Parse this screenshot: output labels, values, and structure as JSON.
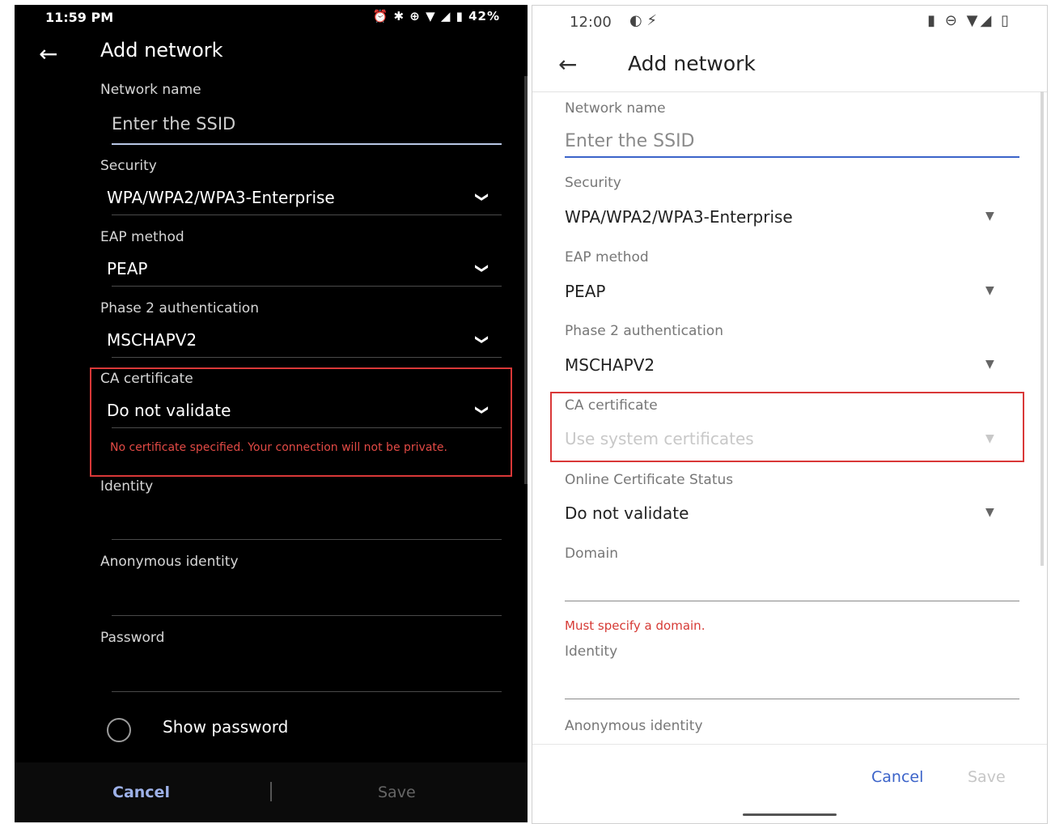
{
  "dark_phone": {
    "status": {
      "time": "11:59 PM",
      "icons": "⏰ ✱ ⊕ ▼ ◢ ▮ 42%"
    },
    "title": "Add network",
    "network_name": {
      "label": "Network name",
      "placeholder": "Enter the SSID"
    },
    "security": {
      "label": "Security",
      "value": "WPA/WPA2/WPA3-Enterprise"
    },
    "eap_method": {
      "label": "EAP method",
      "value": "PEAP"
    },
    "phase2": {
      "label": "Phase 2 authentication",
      "value": "MSCHAPV2"
    },
    "ca_certificate": {
      "label": "CA certificate",
      "value": "Do not validate",
      "warning": "No certificate specified. Your connection will not be private."
    },
    "identity": {
      "label": "Identity"
    },
    "anonymous_identity": {
      "label": "Anonymous identity"
    },
    "password": {
      "label": "Password"
    },
    "show_password": "Show password",
    "buttons": {
      "cancel": "Cancel",
      "save": "Save"
    }
  },
  "light_phone": {
    "status": {
      "time": "12:00",
      "left_icons": "◐ ⚡",
      "right_icons": "▮ ⊖ ▼◢ ▯"
    },
    "title": "Add network",
    "network_name": {
      "label": "Network name",
      "placeholder": "Enter the SSID"
    },
    "security": {
      "label": "Security",
      "value": "WPA/WPA2/WPA3-Enterprise"
    },
    "eap_method": {
      "label": "EAP method",
      "value": "PEAP"
    },
    "phase2": {
      "label": "Phase 2 authentication",
      "value": "MSCHAPV2"
    },
    "ca_certificate": {
      "label": "CA certificate",
      "value": "Use system certificates"
    },
    "ocsp": {
      "label": "Online Certificate Status",
      "value": "Do not validate"
    },
    "domain": {
      "label": "Domain",
      "error": "Must specify a domain."
    },
    "identity": {
      "label": "Identity"
    },
    "anonymous_identity": {
      "label": "Anonymous identity"
    },
    "buttons": {
      "cancel": "Cancel",
      "save": "Save"
    }
  }
}
